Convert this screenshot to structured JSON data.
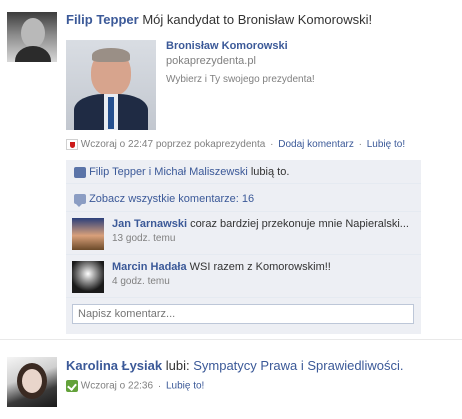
{
  "story1": {
    "actor": "Filip Tepper",
    "message": "Mój kandydat to Bronisław Komorowski!",
    "attachment": {
      "title": "Bronisław Komorowski",
      "url": "pokaprezydenta.pl",
      "description": "Wybierz i Ty swojego prezydenta!"
    },
    "meta": {
      "time": "Wczoraj o 22:47 poprzez pokaprezydenta",
      "sep": "·",
      "add_comment": "Dodaj komentarz",
      "like": "Lubię to!"
    },
    "likes": {
      "names": "Filip Tepper i Michał Maliszewski",
      "suffix": "lubią to."
    },
    "see_all_comments": "Zobacz wszystkie komentarze: 16",
    "comments": [
      {
        "author": "Jan Tarnawski",
        "text": "coraz bardziej przekonuje mnie Napieralski...",
        "time": "13 godz. temu"
      },
      {
        "author": "Marcin Hadała",
        "text": "WSI razem z Komorowskim!!",
        "time": "4 godz. temu"
      }
    ],
    "comment_placeholder": "Napisz komentarz..."
  },
  "story2": {
    "actor": "Karolina Łysiak",
    "verb": "lubi:",
    "object": "Sympatycy Prawa i Sprawiedliwości.",
    "meta": {
      "time": "Wczoraj o 22:36",
      "sep": "·",
      "like": "Lubię to!"
    }
  },
  "colors": {
    "link": "#3b5998",
    "ufi_background": "#edeff4",
    "meta_gray": "#808080"
  }
}
